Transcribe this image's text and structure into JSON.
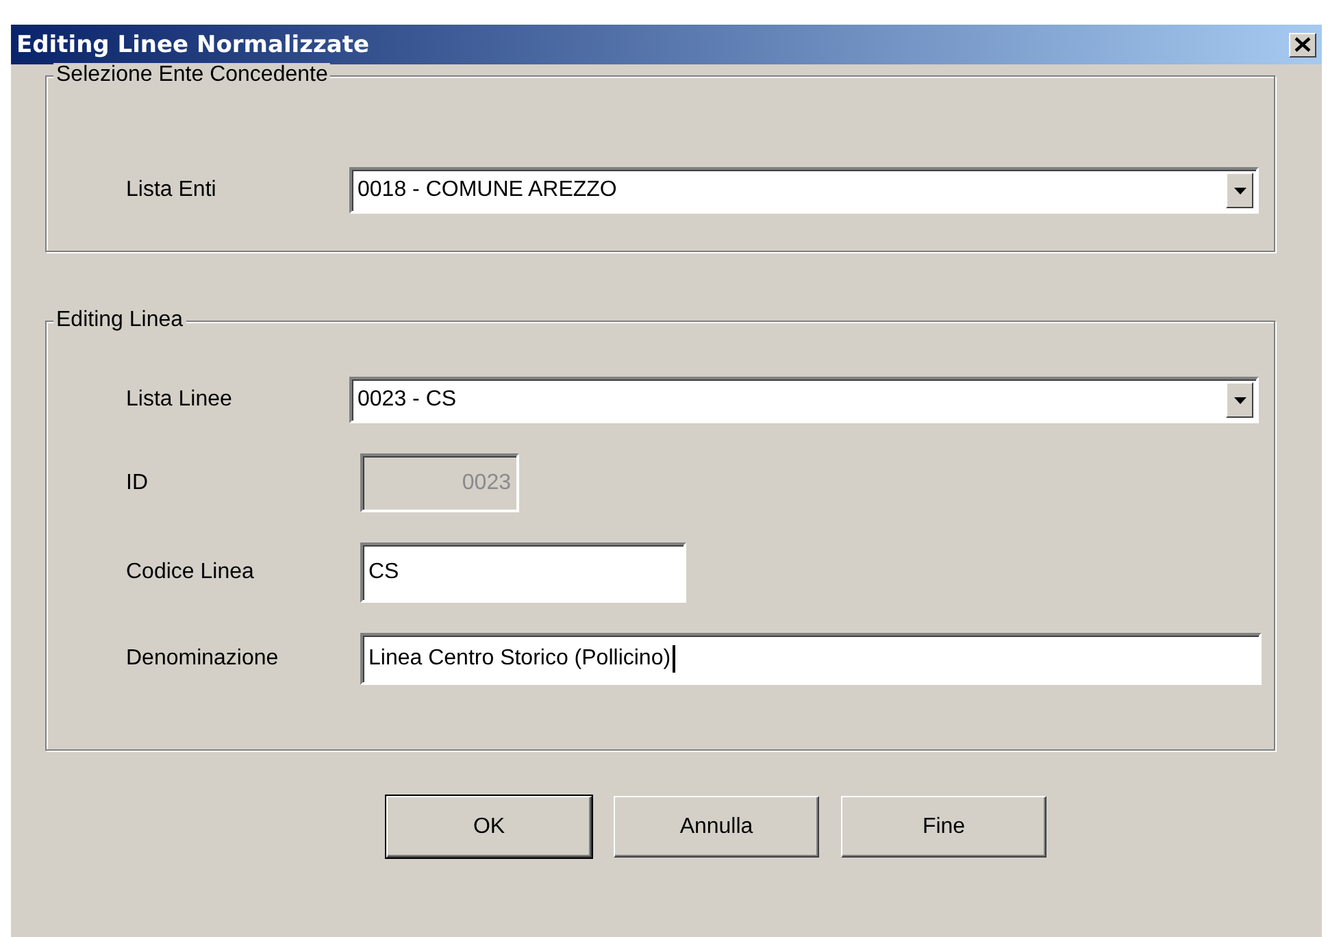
{
  "window": {
    "title": "Editing Linee Normalizzate"
  },
  "groups": [
    {
      "title": "Selezione Ente Concedente",
      "fields": [
        {
          "kind": "combo",
          "label": "Lista Enti",
          "value": "0018 - COMUNE AREZZO"
        }
      ]
    },
    {
      "title": "Editing Linea",
      "fields": [
        {
          "kind": "combo",
          "label": "Lista Linee",
          "value": "0023 - CS"
        },
        {
          "kind": "text",
          "label": "ID",
          "value": "0023",
          "disabled": true,
          "focused": false
        },
        {
          "kind": "text",
          "label": "Codice Linea",
          "value": "CS",
          "disabled": false,
          "focused": false
        },
        {
          "kind": "text",
          "label": "Denominazione",
          "value": "Linea Centro Storico (Pollicino)",
          "disabled": false,
          "focused": true
        }
      ]
    }
  ],
  "buttons": [
    {
      "label": "OK",
      "default": true
    },
    {
      "label": "Annulla",
      "default": false
    },
    {
      "label": "Fine",
      "default": false
    }
  ]
}
